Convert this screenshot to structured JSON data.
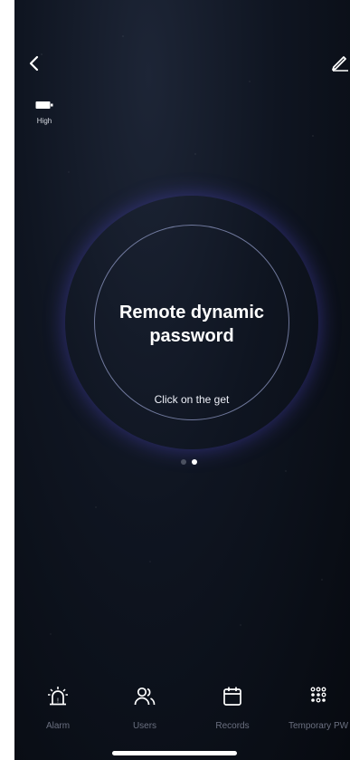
{
  "header": {
    "back_icon": "chevron-left-icon",
    "edit_icon": "pencil-icon"
  },
  "battery": {
    "icon": "battery-icon",
    "label": "High"
  },
  "ring": {
    "title_line1": "Remote dynamic",
    "title_line2": "password",
    "hint": "Click on the get",
    "colors": {
      "ring_primary": "#5d6ff0",
      "ring_secondary": "#6b55e8"
    }
  },
  "pager": {
    "pages": 2,
    "active": 2
  },
  "nav": {
    "alarm": {
      "label": "Alarm",
      "icon": "alarm-siren-icon"
    },
    "users": {
      "label": "Users",
      "icon": "users-icon"
    },
    "records": {
      "label": "Records",
      "icon": "calendar-icon"
    },
    "temporary": {
      "label": "Temporary PW",
      "icon": "keypad-grid-icon"
    }
  }
}
